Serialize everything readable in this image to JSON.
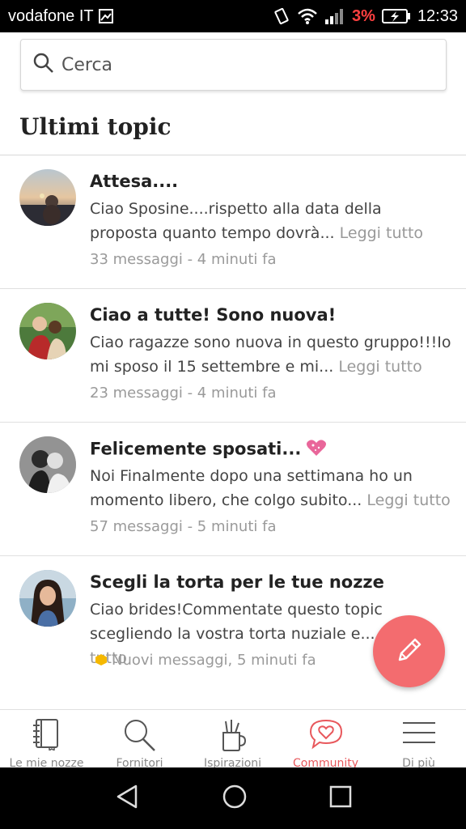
{
  "status_bar": {
    "carrier": "vodafone IT",
    "battery_percent": "3%",
    "time": "12:33"
  },
  "search": {
    "placeholder": "Cerca"
  },
  "section_title": "Ultimi topic",
  "topics": [
    {
      "title": "Attesa....",
      "excerpt": "Ciao Sposine....rispetto alla data della proposta quanto tempo dovrà...",
      "read_more": "Leggi tutto",
      "meta": "33 messaggi - 4 minuti fa"
    },
    {
      "title": "Ciao a tutte! Sono nuova!",
      "excerpt": "Ciao ragazze sono nuova in questo gruppo!!!Io mi sposo il 15 settembre e mi...",
      "read_more": "Leggi tutto",
      "meta": "23 messaggi - 4 minuti fa"
    },
    {
      "title": "Felicemente sposati...",
      "excerpt": "Noi Finalmente dopo una settimana ho un momento libero, che colgo subito...",
      "read_more": "Leggi tutto",
      "meta": "57 messaggi - 5 minuti fa"
    },
    {
      "title": "Scegli la torta per le tue nozze",
      "excerpt": "Ciao brides!Commentate questo topic scegliendo la vostra torta nuziale e...",
      "read_more": "Leggi tutto",
      "meta": "Nuovi messaggi, 5 minuti fa"
    }
  ],
  "bottom_nav": [
    {
      "label": "Le mie nozze",
      "icon": "notebook-icon"
    },
    {
      "label": "Fornitori",
      "icon": "search-icon"
    },
    {
      "label": "Ispirazioni",
      "icon": "brushes-icon"
    },
    {
      "label": "Community",
      "icon": "chat-heart-icon",
      "active": true
    },
    {
      "label": "Di più",
      "icon": "menu-icon"
    }
  ],
  "colors": {
    "accent": "#f36c6f",
    "active_nav": "#e8585c",
    "new_badge": "#f5b800"
  }
}
